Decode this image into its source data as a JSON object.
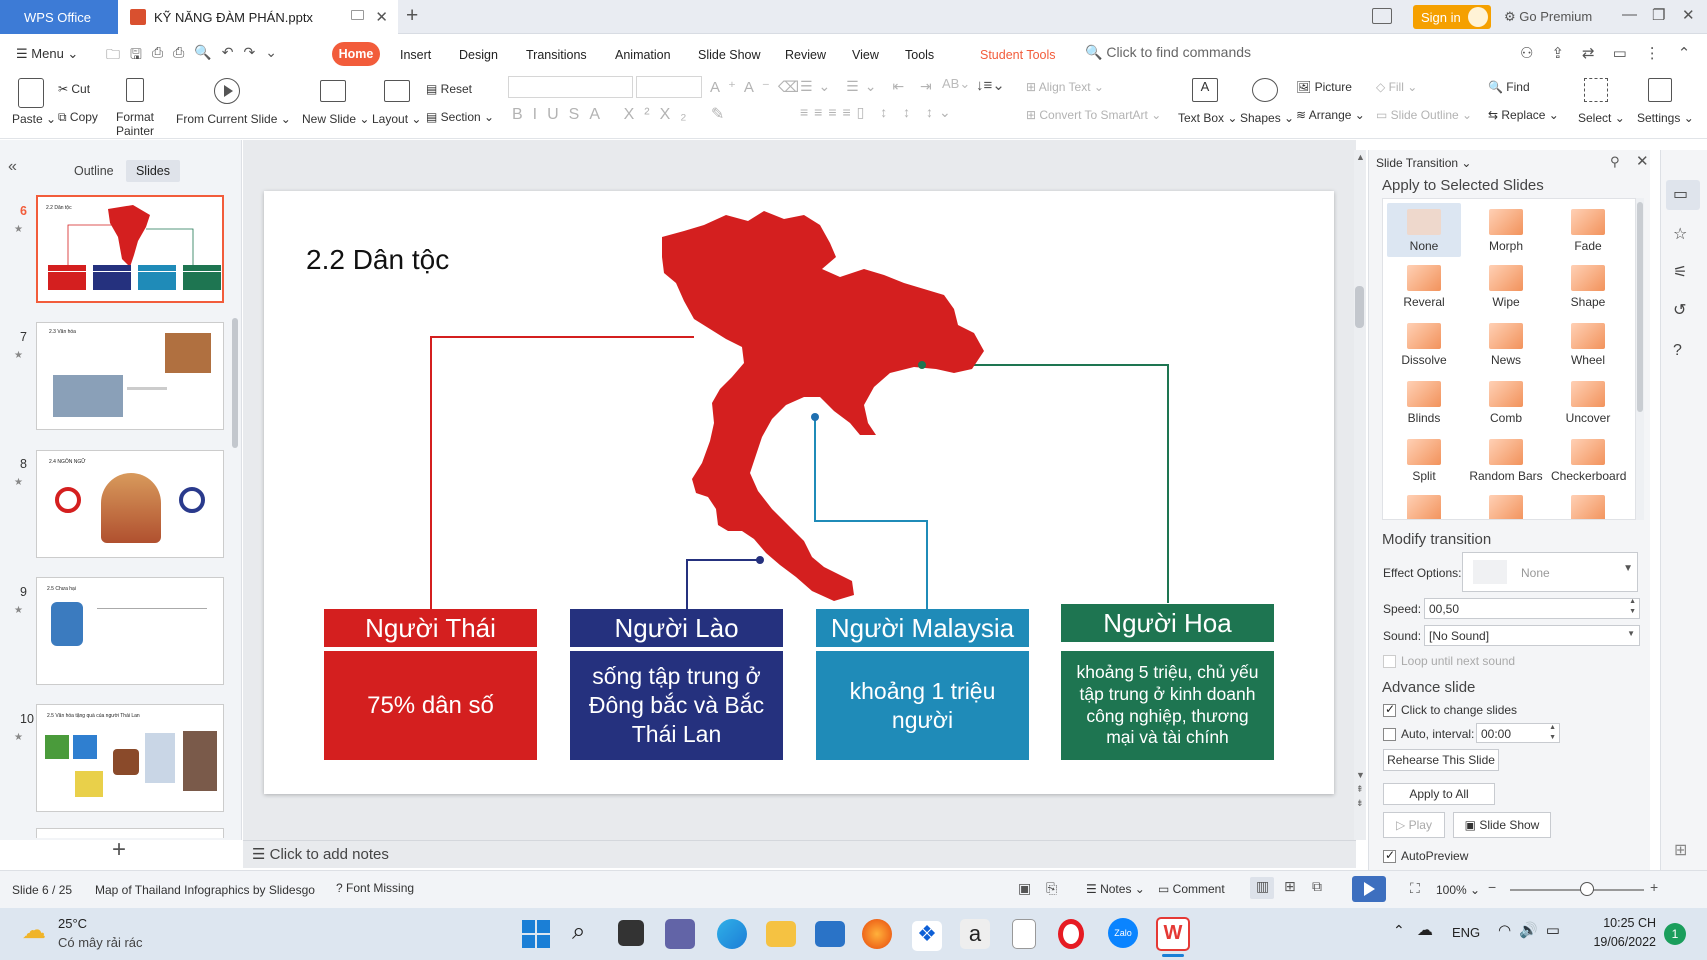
{
  "titlebar": {
    "app_tab": "WPS Office",
    "doc_tab": "KỸ NĂNG ĐÀM PHÁN.pptx",
    "signin": "Sign in",
    "premium": "Go Premium"
  },
  "menu": {
    "menu_label": "Menu",
    "tabs": [
      "Home",
      "Insert",
      "Design",
      "Transitions",
      "Animation",
      "Slide Show",
      "Review",
      "View",
      "Tools",
      "Student Tools"
    ],
    "search_placeholder": "Click to find commands"
  },
  "ribbon": {
    "paste": "Paste",
    "cut": "Cut",
    "copy": "Copy",
    "format_painter_1": "Format",
    "format_painter_2": "Painter",
    "from_current_slide": "From Current Slide",
    "new_slide": "New Slide",
    "layout": "Layout",
    "reset": "Reset",
    "section": "Section",
    "align_text": "Align Text",
    "convert_smartart": "Convert To SmartArt",
    "text_box": "Text Box",
    "shapes": "Shapes",
    "picture": "Picture",
    "arrange": "Arrange",
    "fill": "Fill",
    "slide_outline": "Slide Outline",
    "find": "Find",
    "replace": "Replace",
    "select": "Select",
    "settings": "Settings"
  },
  "left_panel": {
    "tab_outline": "Outline",
    "tab_slides": "Slides",
    "slide_numbers": [
      "6",
      "7",
      "8",
      "9",
      "10"
    ],
    "thumb_titles": [
      "2.2 Dân tộc",
      "2.3 Văn hóa",
      "2.4 NGÔN NGỮ",
      "2.5 Chưa hại",
      "2.5 Văn hóa tặng quà của người Thái Lan"
    ]
  },
  "slide": {
    "title": "2.2 Dân tộc",
    "groups": [
      {
        "name": "Người Thái",
        "desc": "75% dân số",
        "header_color": "#d41f1f",
        "body_color": "#d41f1f"
      },
      {
        "name": "Người Lào",
        "desc": "sống tập trung ở Đông bắc và Bắc Thái Lan",
        "header_color": "#25317e",
        "body_color": "#25317e"
      },
      {
        "name": "Người Malaysia",
        "desc": "khoảng 1 triệu người",
        "header_color": "#1f8bb8",
        "body_color": "#1f8bb8"
      },
      {
        "name": "Người Hoa",
        "desc": "khoảng 5 triệu, chủ yếu tập trung ở kinh doanh công nghiệp, thương mại và tài chính",
        "header_color": "#1e7551",
        "body_color": "#1e7551"
      }
    ]
  },
  "notes_placeholder": "Click to add notes",
  "right_panel": {
    "panel_title": "Slide Transition",
    "apply_selected": "Apply to Selected Slides",
    "transitions": [
      "None",
      "Morph",
      "Fade",
      "Reveral",
      "Wipe",
      "Shape",
      "Dissolve",
      "News",
      "Wheel",
      "Blinds",
      "Comb",
      "Uncover",
      "Split",
      "Random Bars",
      "Checkerboard"
    ],
    "modify_heading": "Modify transition",
    "effect_options_label": "Effect Options:",
    "effect_options_value": "None",
    "speed_label": "Speed:",
    "speed_value": "00,50",
    "sound_label": "Sound:",
    "sound_value": "[No Sound]",
    "loop_label": "Loop until next sound",
    "advance_heading": "Advance slide",
    "click_change": "Click to change slides",
    "auto_interval": "Auto, interval:",
    "interval_value": "00:00",
    "rehearse": "Rehearse This Slide",
    "apply_all": "Apply to All",
    "play": "Play",
    "slide_show": "Slide Show",
    "autopreview": "AutoPreview"
  },
  "status": {
    "slide_pos": "Slide 6 / 25",
    "theme": "Map of Thailand Infographics by Slidesgo",
    "font_missing": "Font Missing",
    "notes": "Notes",
    "comment": "Comment",
    "zoom": "100%"
  },
  "taskbar": {
    "temp": "25°C",
    "weather": "Có mây rải rác",
    "lang": "ENG",
    "time": "10:25 CH",
    "date": "19/06/2022",
    "badge": "1"
  }
}
